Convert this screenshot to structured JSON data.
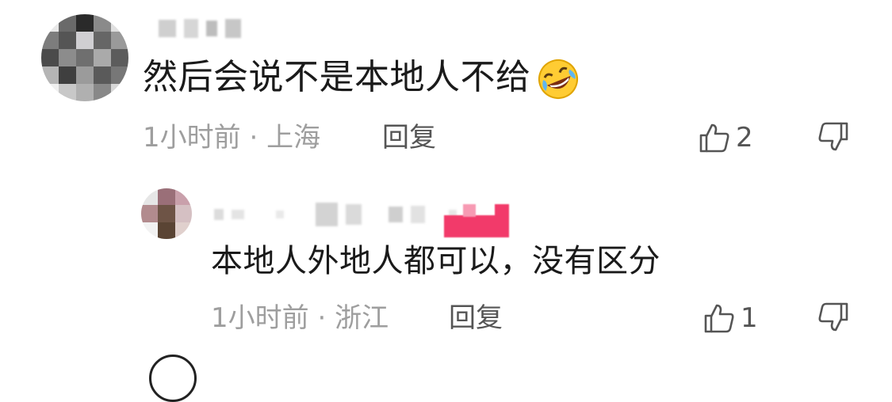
{
  "comments": [
    {
      "text": "然后会说不是本地人不给",
      "emoji": "rolling-on-floor-laughing-emoji",
      "time": "1小时前",
      "separator": "·",
      "location": "上海",
      "reply_label": "回复",
      "likes": "2",
      "icons": {
        "like": "thumbs-up-icon",
        "dislike": "thumbs-down-icon"
      }
    },
    {
      "text": "本地人外地人都可以，没有区分",
      "time": "1小时前",
      "separator": "·",
      "location": "浙江",
      "reply_label": "回复",
      "likes": "1",
      "icons": {
        "like": "thumbs-up-icon",
        "dislike": "thumbs-down-icon"
      }
    }
  ],
  "colors": {
    "text": "#1a1a1a",
    "meta": "#9e9e9e",
    "action": "#555555",
    "badge_pink": "#f23a6a"
  }
}
